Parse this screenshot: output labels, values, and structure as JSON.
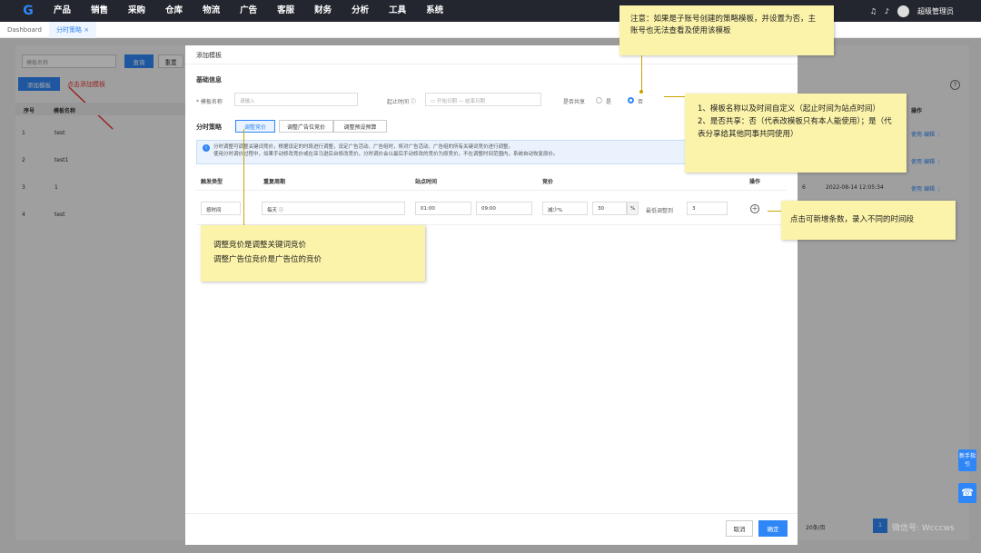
{
  "topbar": {
    "logo": "G",
    "nav": [
      "产品",
      "销售",
      "采购",
      "仓库",
      "物流",
      "广告",
      "客服",
      "财务",
      "分析",
      "工具",
      "系统"
    ],
    "user": "超级管理员"
  },
  "tabs": [
    "Dashboard",
    "分时策略 ×"
  ],
  "background": {
    "search_placeholder": "模板名称",
    "search_btn": "查询",
    "reset_btn": "重置",
    "add_btn": "添加模板",
    "add_annotation": "点击添加模板",
    "col_no": "序号",
    "col_name": "模板名称",
    "rows": [
      {
        "no": "1",
        "name": "test"
      },
      {
        "no": "2",
        "name": "test1"
      },
      {
        "no": "3",
        "name": "1"
      },
      {
        "no": "4",
        "name": "test"
      }
    ],
    "right_no": "6",
    "right_date": "2022-08-14 12:05:34",
    "right_col": "操作",
    "action_use": "使用",
    "action_edit": "编辑",
    "pager_total": "20条/页",
    "pager_page": "1",
    "help": "新手指引"
  },
  "modal": {
    "title": "添加模板",
    "basic_section": "基础信息",
    "name_label": "* 模板名称",
    "name_placeholder": "请输入",
    "time_label": "起止时间 ⓘ",
    "date_start_ph": "开始日期",
    "date_sep": "—",
    "date_end_ph": "结束日期",
    "share_label": "是否共享",
    "share_yes": "是",
    "share_no": "否",
    "strategy_label": "分时策略",
    "seg_tabs": [
      "调整竞价",
      "调整广告位竞价",
      "调整预设预算"
    ],
    "info_text_1": "分时调整可调整关键词竞价，根据设定的时段进行调整，设定广告活动、广告组时，将对广告活动、广告组的所有关键词竞价进行调整。",
    "info_text_2": "使用分时调价过程中，如果手动修改竞价或在亚马逊后台修改竞价，分时调价会以最后手动修改的竞价为原竞价，不在调整时间范围内，系统自动恢复原价。",
    "th_type": "触发类型",
    "th_cycle": "重复周期",
    "th_time": "站点时间",
    "th_bid": "竞价",
    "th_op": "操作",
    "row_type": "按时间",
    "row_cycle": "每天 ⓘ",
    "row_start": "01:00",
    "row_end": "09:00",
    "row_mode": "减少%",
    "row_value": "30",
    "row_unit": "%",
    "row_max_label": "最低调整到",
    "row_max": "3",
    "cancel": "取消",
    "confirm": "确定"
  },
  "notes": {
    "top": "注意：如果是子账号创建的策略模板，并设置为否，主账号也无法查看及使用该模板",
    "right_1": "1、模板名称以及时间自定义（起止时间为站点时间）",
    "right_2": "2、是否共享：否（代表改模板只有本人能使用）；是（代表分享给其他同事共同使用）",
    "add_row": "点击可新增条数，录入不同的时间段",
    "bid_1": "调整竞价是调整关键词竞价",
    "bid_2": "调整广告位竞价是广告位的竞价"
  },
  "watermark": "微信号: Wcccws"
}
